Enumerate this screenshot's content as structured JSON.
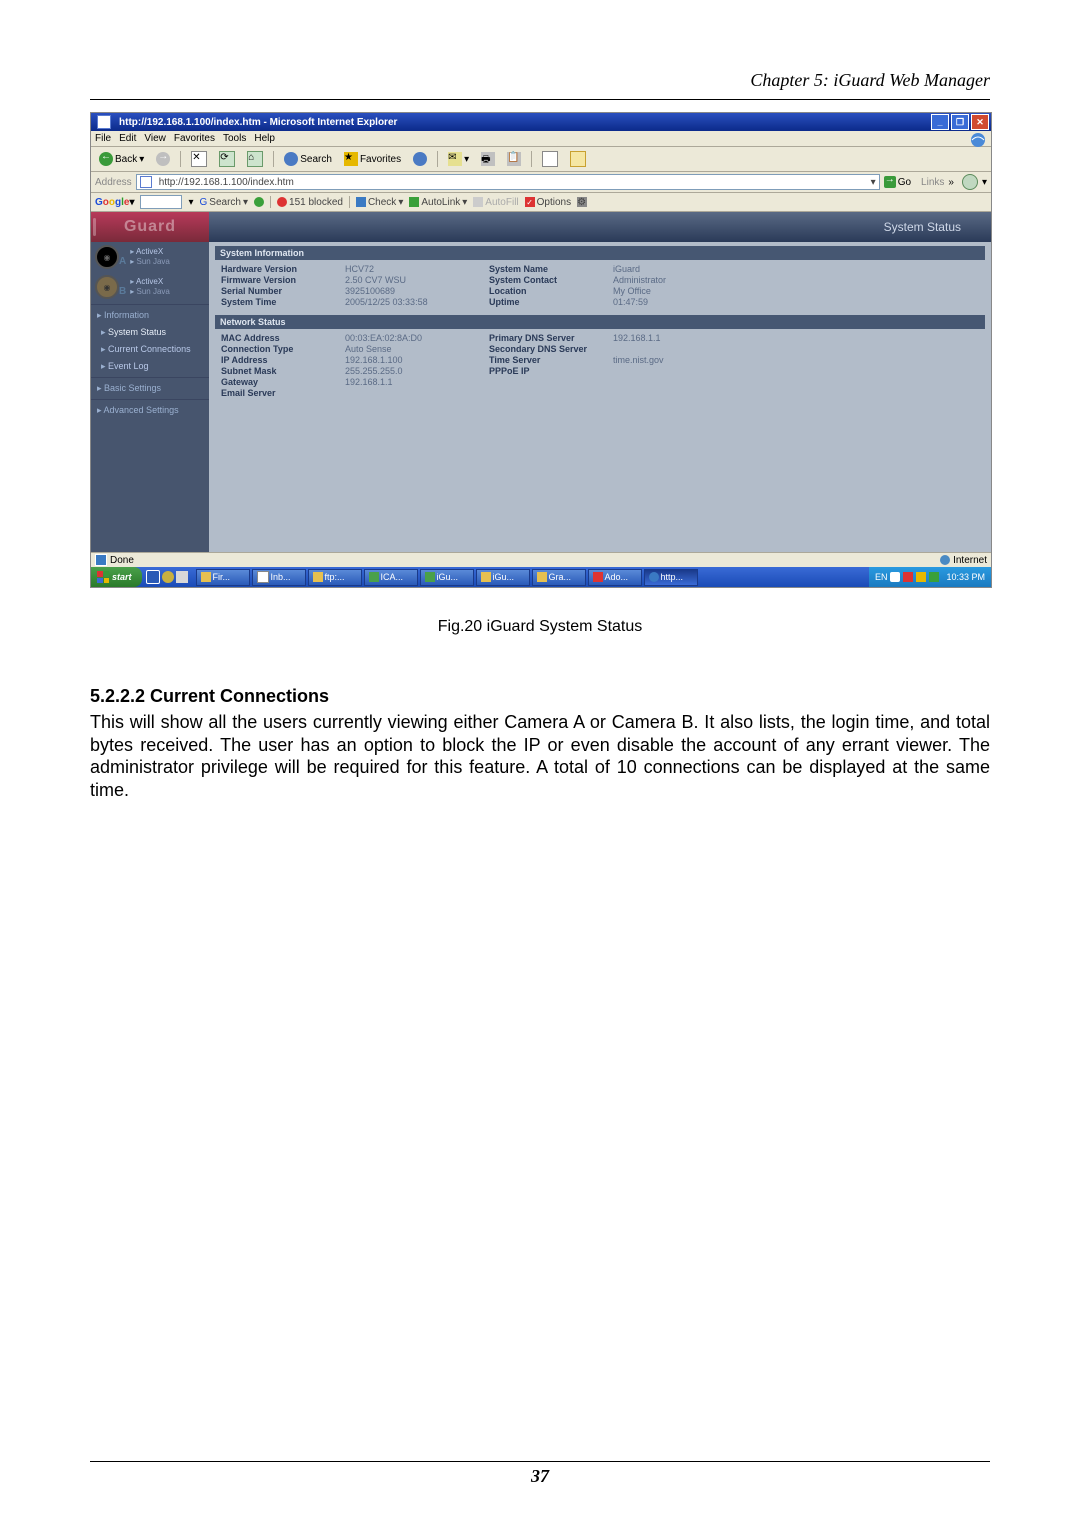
{
  "chapter_header": "Chapter 5: iGuard Web Manager",
  "browser": {
    "title": "http://192.168.1.100/index.htm - Microsoft Internet Explorer",
    "menubar": [
      "File",
      "Edit",
      "View",
      "Favorites",
      "Tools",
      "Help"
    ],
    "toolbar": {
      "back": "Back",
      "search": "Search",
      "favorites": "Favorites"
    },
    "address": {
      "label": "Address",
      "url": "http://192.168.1.100/index.htm",
      "go": "Go",
      "links": "Links"
    },
    "googlebar": {
      "search_btn": "Search",
      "blocked": "151 blocked",
      "check": "Check",
      "autolink": "AutoLink",
      "autofill": "AutoFill",
      "options": "Options"
    },
    "status": {
      "done": "Done",
      "zone": "Internet"
    }
  },
  "page": {
    "logo": "Guard",
    "banner": "System Status",
    "sidebar": {
      "camA": {
        "ax": "ActiveX",
        "sj": "Sun Java"
      },
      "camB": {
        "ax": "ActiveX",
        "sj": "Sun Java"
      },
      "info": "Information",
      "sys_status": "System Status",
      "cur_conn": "Current Connections",
      "event_log": "Event Log",
      "basic": "Basic Settings",
      "advanced": "Advanced Settings"
    },
    "sysinfo": {
      "header": "System Information",
      "rows": {
        "hw_version_l": "Hardware Version",
        "hw_version_v": "HCV72",
        "fw_version_l": "Firmware Version",
        "fw_version_v": "2.50 CV7 WSU",
        "serial_l": "Serial Number",
        "serial_v": "3925100689",
        "systime_l": "System Time",
        "systime_v": "2005/12/25 03:33:58",
        "sysname_l": "System Name",
        "sysname_v": "iGuard",
        "syscontact_l": "System Contact",
        "syscontact_v": "Administrator",
        "location_l": "Location",
        "location_v": "My Office",
        "uptime_l": "Uptime",
        "uptime_v": "01:47:59"
      }
    },
    "netstatus": {
      "header": "Network Status",
      "rows": {
        "mac_l": "MAC Address",
        "mac_v": "00:03:EA:02:8A:D0",
        "conn_l": "Connection Type",
        "conn_v": "Auto Sense",
        "ip_l": "IP Address",
        "ip_v": "192.168.1.100",
        "subnet_l": "Subnet Mask",
        "subnet_v": "255.255.255.0",
        "gw_l": "Gateway",
        "gw_v": "192.168.1.1",
        "email_l": "Email Server",
        "email_v": "",
        "pdns_l": "Primary DNS Server",
        "pdns_v": "192.168.1.1",
        "sdns_l": "Secondary DNS Server",
        "sdns_v": "",
        "ts_l": "Time Server",
        "ts_v": "time.nist.gov",
        "pppoe_l": "PPPoE IP",
        "pppoe_v": ""
      }
    }
  },
  "taskbar": {
    "start": "start",
    "tasks": [
      "Fir...",
      "Inb...",
      "ftp:...",
      "ICA...",
      "iGu...",
      "iGu...",
      "Gra...",
      "Ado...",
      "http..."
    ],
    "lang": "EN",
    "time": "10:33 PM"
  },
  "caption": "Fig.20  iGuard System Status",
  "section": {
    "heading": "5.2.2.2 Current Connections",
    "body": "This will show all the users currently viewing either Camera A or Camera B.   It also lists, the login time, and total bytes received.   The user has an option to block the IP or even disable the account of any errant viewer.   The administrator privilege will be required for this feature.   A total of 10 connections can be displayed at the same time."
  },
  "page_number": "37"
}
